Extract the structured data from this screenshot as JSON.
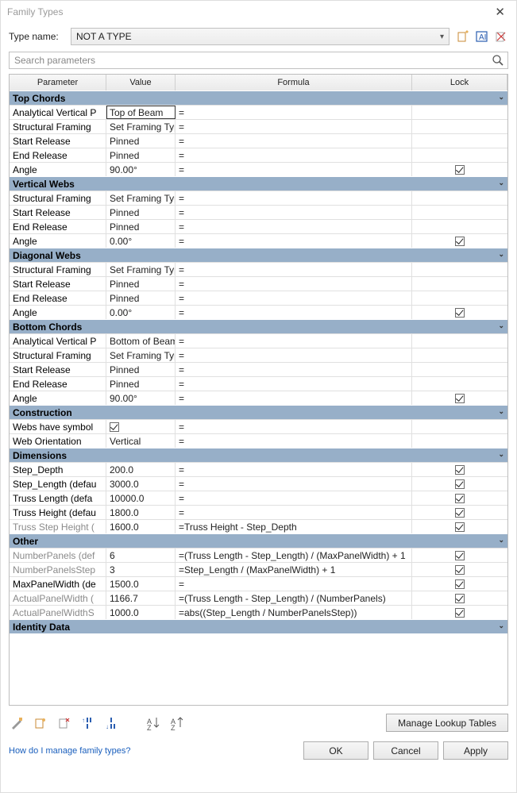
{
  "window": {
    "title": "Family Types"
  },
  "type_name": {
    "label": "Type name:",
    "value": "NOT A TYPE"
  },
  "search": {
    "placeholder": "Search parameters"
  },
  "columns": {
    "param": "Parameter",
    "value": "Value",
    "formula": "Formula",
    "lock": "Lock"
  },
  "groups": [
    {
      "title": "Top Chords",
      "rows": [
        {
          "param": "Analytical Vertical P",
          "value": "Top of Beam",
          "formula": "=",
          "framed": true
        },
        {
          "param": "Structural Framing",
          "value": "Set Framing Type",
          "formula": "="
        },
        {
          "param": "Start Release",
          "value": "Pinned",
          "formula": "="
        },
        {
          "param": "End Release",
          "value": "Pinned",
          "formula": "="
        },
        {
          "param": "Angle",
          "value": "90.00°",
          "formula": "=",
          "lock": true
        }
      ]
    },
    {
      "title": "Vertical Webs",
      "rows": [
        {
          "param": "Structural Framing",
          "value": "Set Framing Type",
          "formula": "="
        },
        {
          "param": "Start Release",
          "value": "Pinned",
          "formula": "="
        },
        {
          "param": "End Release",
          "value": "Pinned",
          "formula": "="
        },
        {
          "param": "Angle",
          "value": "0.00°",
          "formula": "=",
          "lock": true
        }
      ]
    },
    {
      "title": "Diagonal Webs",
      "rows": [
        {
          "param": "Structural Framing",
          "value": "Set Framing Type",
          "formula": "="
        },
        {
          "param": "Start Release",
          "value": "Pinned",
          "formula": "="
        },
        {
          "param": "End Release",
          "value": "Pinned",
          "formula": "="
        },
        {
          "param": "Angle",
          "value": "0.00°",
          "formula": "=",
          "lock": true
        }
      ]
    },
    {
      "title": "Bottom Chords",
      "rows": [
        {
          "param": "Analytical Vertical P",
          "value": "Bottom of Beam",
          "formula": "="
        },
        {
          "param": "Structural Framing",
          "value": "Set Framing Type",
          "formula": "="
        },
        {
          "param": "Start Release",
          "value": "Pinned",
          "formula": "="
        },
        {
          "param": "End Release",
          "value": "Pinned",
          "formula": "="
        },
        {
          "param": "Angle",
          "value": "90.00°",
          "formula": "=",
          "lock": true
        }
      ]
    },
    {
      "title": "Construction",
      "rows": [
        {
          "param": "Webs have symbol",
          "value_checkbox": true,
          "formula": "="
        },
        {
          "param": "Web Orientation",
          "value": "Vertical",
          "formula": "="
        }
      ]
    },
    {
      "title": "Dimensions",
      "rows": [
        {
          "param": "Step_Depth",
          "value": "200.0",
          "formula": "=",
          "lock": true
        },
        {
          "param": "Step_Length (defau",
          "value": "3000.0",
          "formula": "=",
          "lock": true
        },
        {
          "param": "Truss Length (defa",
          "value": "10000.0",
          "formula": "=",
          "lock": true
        },
        {
          "param": "Truss Height (defau",
          "value": "1800.0",
          "formula": "=",
          "lock": true
        },
        {
          "param": "Truss Step Height (",
          "value": "1600.0",
          "formula": "=Truss Height - Step_Depth",
          "lock": true,
          "gray": true
        }
      ]
    },
    {
      "title": "Other",
      "rows": [
        {
          "param": "NumberPanels (def",
          "value": "6",
          "formula": "=(Truss Length - Step_Length) / (MaxPanelWidth) + 1",
          "lock": true,
          "gray": true
        },
        {
          "param": "NumberPanelsStep",
          "value": "3",
          "formula": "=Step_Length / (MaxPanelWidth) + 1",
          "lock": true,
          "gray": true
        },
        {
          "param": "MaxPanelWidth (de",
          "value": "1500.0",
          "formula": "=",
          "lock": true
        },
        {
          "param": "ActualPanelWidth (",
          "value": "1166.7",
          "formula": "=(Truss Length - Step_Length) / (NumberPanels)",
          "lock": true,
          "gray": true
        },
        {
          "param": "ActualPanelWidthS",
          "value": "1000.0",
          "formula": "=abs((Step_Length / NumberPanelsStep))",
          "lock": true,
          "gray": true
        }
      ]
    },
    {
      "title": "Identity Data",
      "body": "empty"
    }
  ],
  "buttons": {
    "manage_lookup": "Manage Lookup Tables",
    "ok": "OK",
    "cancel": "Cancel",
    "apply": "Apply"
  },
  "help_link": "How do I manage family types?"
}
